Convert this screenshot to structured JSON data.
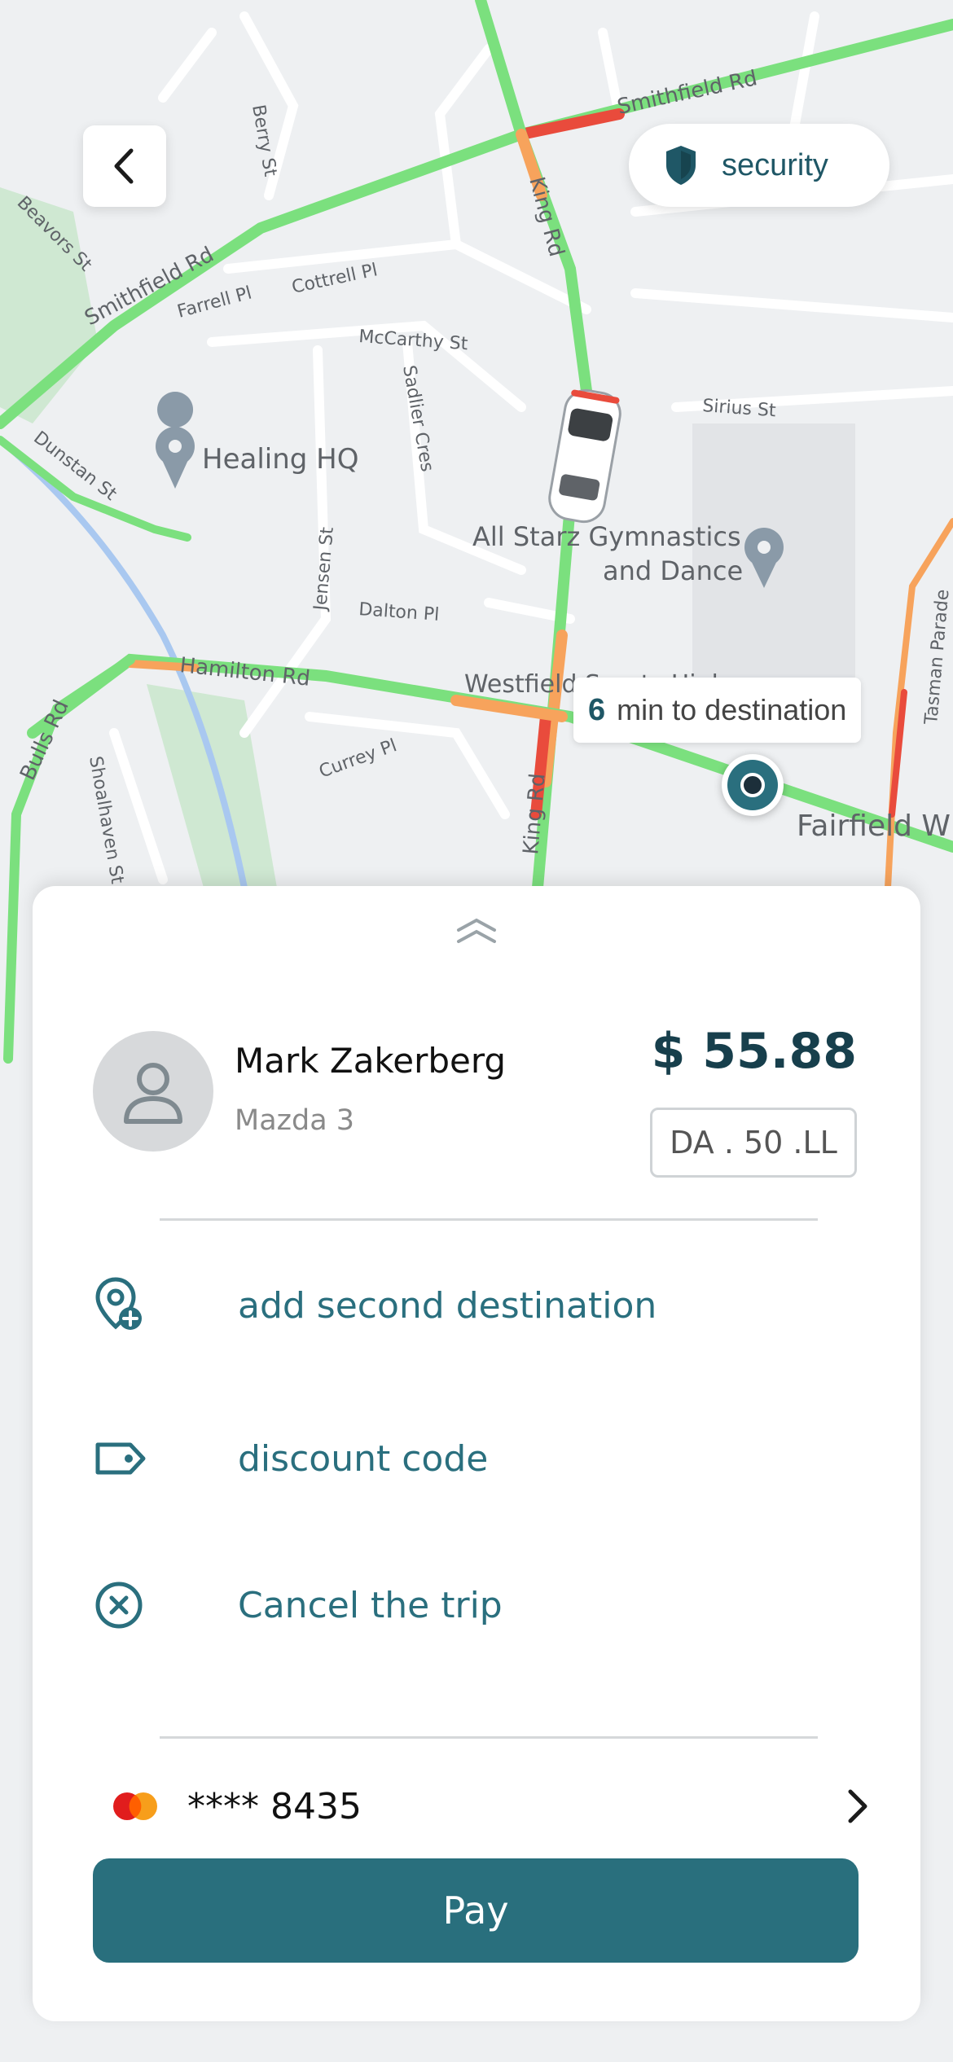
{
  "map": {
    "streets": [
      "Smithfield Rd",
      "Smithfield Rd",
      "King Rd",
      "King Rd",
      "Hamilton Rd",
      "Bulls Rd",
      "Dunstan St",
      "Farrell Pl",
      "Cottrell Pl",
      "McCarthy St",
      "Sadlier Cres",
      "Jensen St",
      "Dalton Pl",
      "Currey Pl",
      "Berry St",
      "Sirius St",
      "Tasman Parade",
      "Shoalhaven St",
      "Beavors St",
      "Fairfield W"
    ],
    "places": [
      "Healing HQ",
      "All Starz Gymnastics",
      "and Dance",
      "Westfield Sports High"
    ],
    "road_colors": {
      "fast": "#7be07e",
      "slow": "#f7a35c",
      "jam": "#e94b3c"
    }
  },
  "header": {
    "back_icon": "chevron-left-icon",
    "security_label": "security",
    "security_icon": "shield-icon"
  },
  "eta": {
    "minutes": "6",
    "text": "min to destination"
  },
  "driver": {
    "name": "Mark Zakerberg",
    "car": "Mazda 3",
    "price": "$ 55.88",
    "currency": "DA . 50 .LL"
  },
  "options": [
    {
      "label": "add second destination",
      "icon": "location-add-icon"
    },
    {
      "label": "discount code",
      "icon": "tag-icon"
    },
    {
      "label": "Cancel the trip",
      "icon": "close-circle-icon"
    }
  ],
  "payment": {
    "card_mask": "**** 8435",
    "card_brand_icon": "mastercard-icon",
    "pay_label": "Pay"
  },
  "colors": {
    "accent": "#2a6f7e",
    "price": "#173f4c"
  }
}
